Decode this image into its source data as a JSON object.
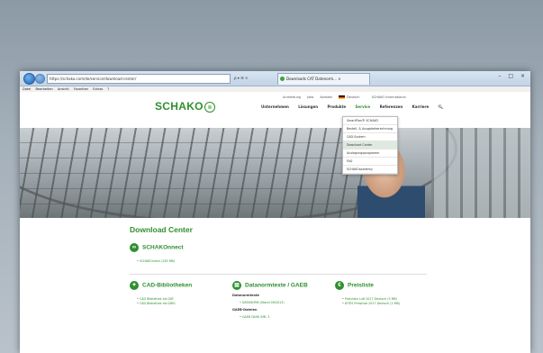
{
  "browser": {
    "address": "https://schako.com/de/service/download-center/",
    "addr_tools": "ρ ▾ ☰ ×",
    "tab_title": "Downloads CAT Datenorm... ×",
    "window_controls": "– □ ×",
    "menu": [
      "Datei",
      "Bearbeiten",
      "Ansicht",
      "Favoriten",
      "Extras",
      "?"
    ]
  },
  "site": {
    "logo": "SCHAKO",
    "topnav": [
      "Anmeldung",
      "Jobs",
      "Kontakt",
      "Deutsch",
      "SCHAKO International"
    ],
    "mainnav": [
      "Unternehmen",
      "Lösungen",
      "Produkte",
      "Service",
      "Referenzen",
      "Karriere"
    ],
    "active_nav": "Service",
    "dropdown": [
      "SmartPlan® SCHAKO",
      "Bestell- & Ausgabeberechnung",
      "CAD-System",
      "Download Center",
      "Auslegungsprogramm",
      "FAQ",
      "SCHAKOacademy"
    ],
    "dropdown_highlight": 3
  },
  "content": {
    "title": "Download Center",
    "schakonnect": {
      "title": "SCHAKOnnect",
      "items": [
        "SCHAKOnnect (283 MB)"
      ]
    },
    "cad": {
      "title": "CAD-Bibliotheken",
      "items": [
        "CAD Bibliothek als DXF",
        "CAD Bibliothek als DWG"
      ]
    },
    "datanorm": {
      "title": "Datanormtexte / GAEB",
      "sub1": "Datanormtexte",
      "items1": [
        "DATANORM (Stand 09/2013)"
      ],
      "sub2": "GAEB-Dateien",
      "items2": [
        "GAEB DA90 XML 3"
      ]
    },
    "preisliste": {
      "title": "Preisliste",
      "items": [
        "Preisliste Luft 2017 Deutsch (5 MB)",
        "KITES Preisliste 2017 Deutsch (1 MB)"
      ]
    }
  },
  "colors": {
    "brand": "#2f8f2f"
  }
}
